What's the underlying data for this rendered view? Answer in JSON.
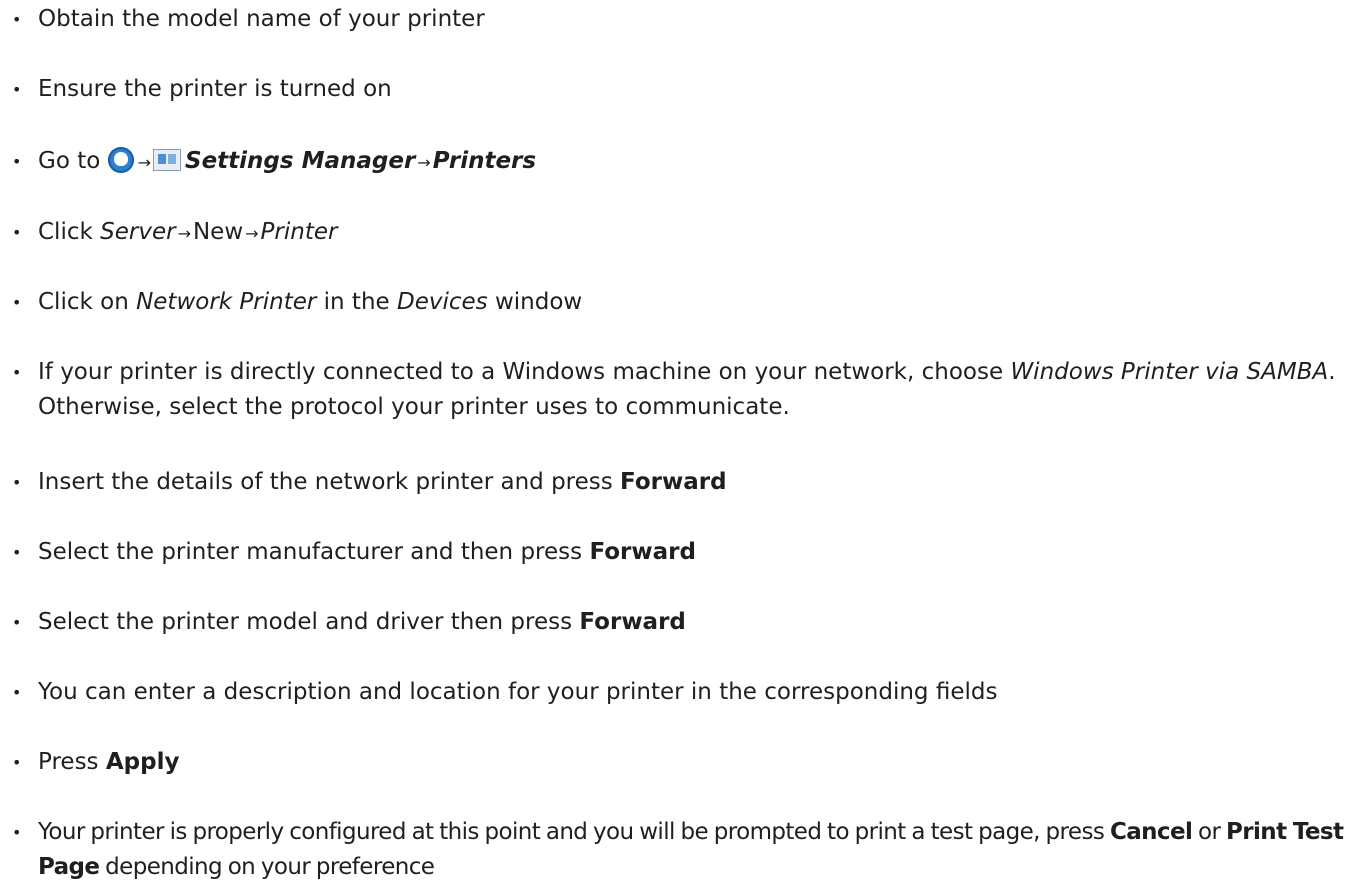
{
  "bullet": "•",
  "arrow": "→",
  "steps": [
    {
      "text": "Obtain the model name of your printer"
    },
    {
      "text": "Ensure the printer is turned on"
    },
    {
      "prefix": "Go to",
      "launcher_icon": "launcher-icon",
      "settings_icon": "settings-manager-icon",
      "settings_manager": "Settings Manager",
      "printers": "Printers"
    },
    {
      "prefix": "Click",
      "server": "Server",
      "new": "New",
      "printer": "Printer"
    },
    {
      "prefix": "Click on",
      "network_printer": "Network Printer",
      "middle": "in the",
      "devices": "Devices",
      "suffix": "window"
    },
    {
      "prefix": "If your printer is directly connected to a Windows machine on your network, choose",
      "windows_printer": "Windows Printer via SAMBA",
      "suffix": ". Otherwise, select the protocol your printer uses to communicate."
    },
    {
      "prefix": "Insert the details of the network printer and press",
      "button": "Forward"
    },
    {
      "prefix": "Select the printer manufacturer and then press",
      "button": "Forward"
    },
    {
      "prefix": "Select the printer model and driver then press",
      "button": "Forward"
    },
    {
      "text": "You can enter a description and location for your printer in the corresponding fields"
    },
    {
      "prefix": "Press",
      "button": "Apply"
    },
    {
      "prefix": "Your printer is properly configured at this point and you will be prompted to print a test page, press",
      "cancel": "Cancel",
      "middle": "or",
      "print_test_page": "Print Test Page",
      "suffix": "depending on your preference"
    }
  ]
}
